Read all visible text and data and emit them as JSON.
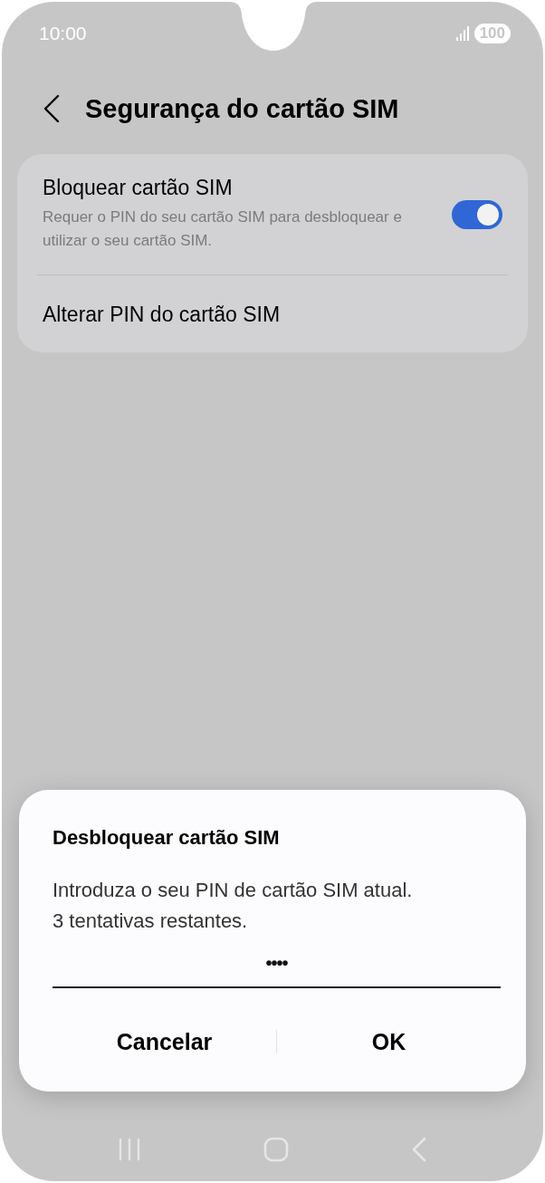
{
  "status_bar": {
    "time": "10:00",
    "battery": "100"
  },
  "header": {
    "title": "Segurança do cartão SIM"
  },
  "settings": [
    {
      "kind": "switch",
      "title": "Bloquear cartão SIM",
      "summary": "Requer o PIN do seu cartão SIM para desbloquear e utilizar o seu cartão SIM.",
      "on": true
    },
    {
      "kind": "plain",
      "title": "Alterar PIN do cartão SIM"
    }
  ],
  "dialog": {
    "title": "Desbloquear cartão SIM",
    "message": "Introduza o seu PIN de cartão SIM atual.\n3 tentativas restantes.",
    "pin_value": "••••",
    "buttons": [
      "Cancelar",
      "OK"
    ]
  }
}
